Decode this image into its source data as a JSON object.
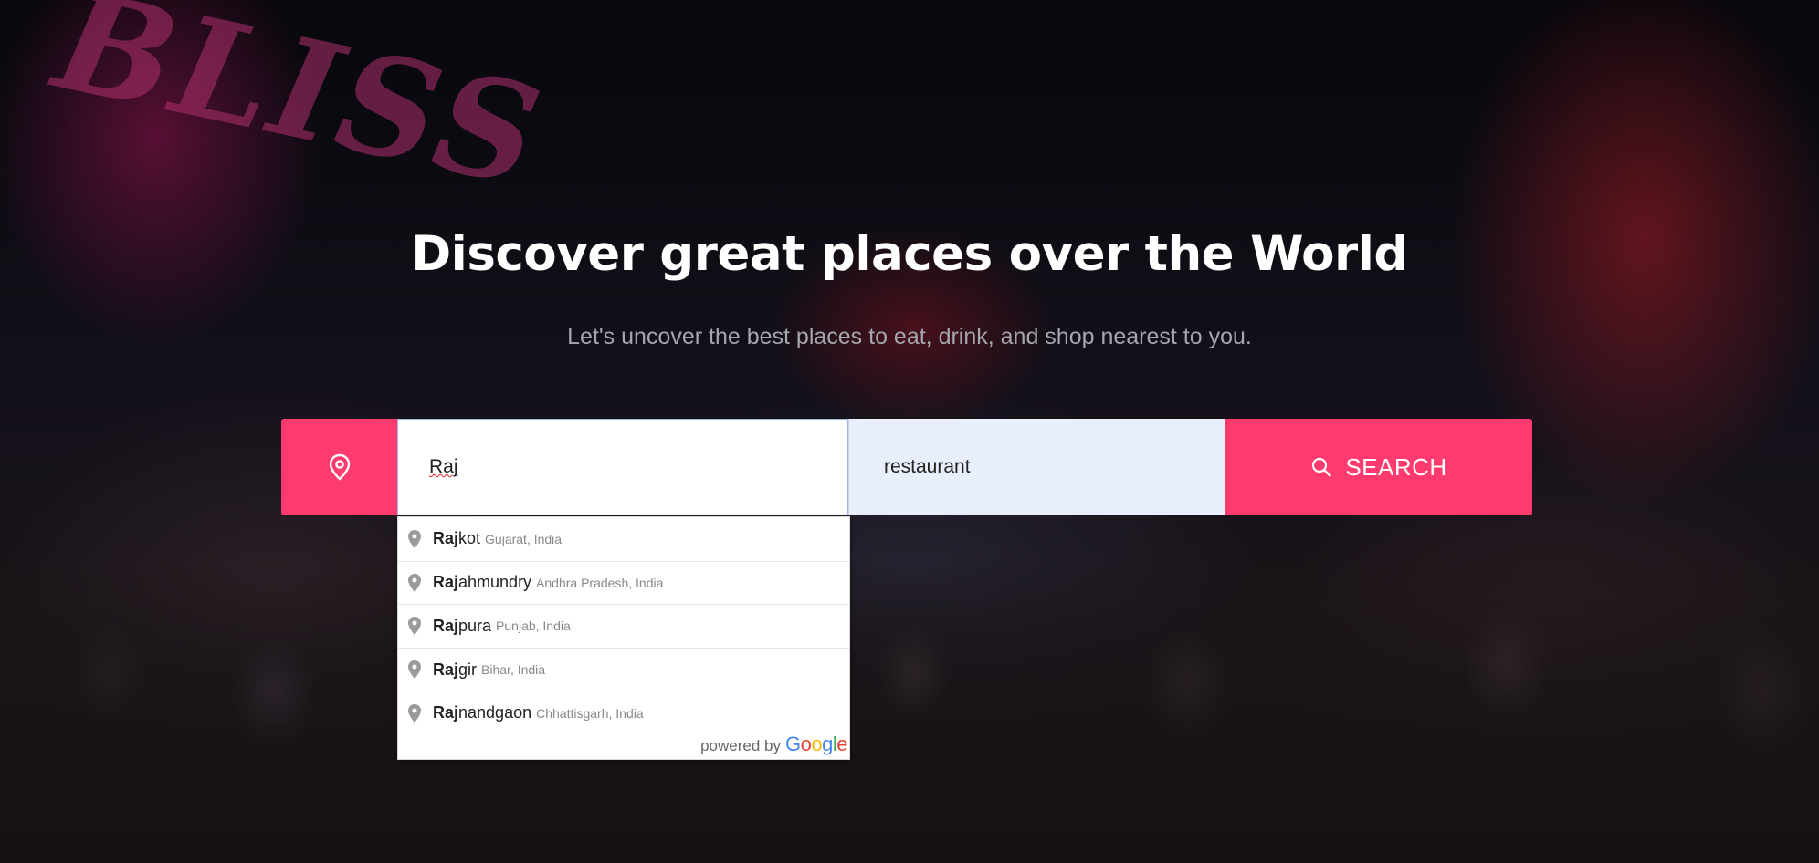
{
  "hero": {
    "title": "Discover great places over the World",
    "subtitle": "Let's uncover the best places to eat, drink, and shop nearest to you."
  },
  "search": {
    "location_value": "Raj",
    "keyword_value": "restaurant",
    "button_label": "SEARCH",
    "location_icon": "map-pin-icon",
    "button_icon": "search-icon"
  },
  "autocomplete": {
    "items": [
      {
        "match": "Raj",
        "rest": "kot",
        "secondary": "Gujarat, India"
      },
      {
        "match": "Raj",
        "rest": "ahmundry",
        "secondary": "Andhra Pradesh, India"
      },
      {
        "match": "Raj",
        "rest": "pura",
        "secondary": "Punjab, India"
      },
      {
        "match": "Raj",
        "rest": "gir",
        "secondary": "Bihar, India"
      },
      {
        "match": "Raj",
        "rest": "nandgaon",
        "secondary": "Chhattisgarh, India"
      }
    ],
    "powered_by": "powered by",
    "provider": "Google"
  },
  "colors": {
    "accent": "#ff3a6f",
    "keyword_bg": "#e8effb"
  }
}
